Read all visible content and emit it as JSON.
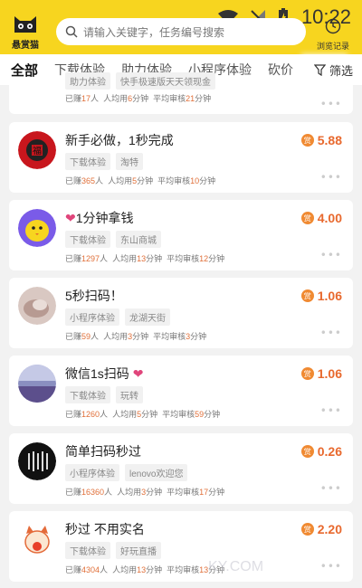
{
  "app": {
    "logo_text": "悬赏猫",
    "time": "10:22",
    "search_placeholder": "请输入关键字，任务编号搜索",
    "history_label": "浏览记录",
    "filter_label": "筛选"
  },
  "tabs": [
    {
      "label": "全部"
    },
    {
      "label": "下载体验"
    },
    {
      "label": "助力体验"
    },
    {
      "label": "小程序体验"
    },
    {
      "label": "砍价"
    }
  ],
  "partial_card": {
    "tags": [
      "助力体验",
      "快手极速版天天领现金"
    ],
    "done_count": "17",
    "avg_time": "6",
    "review_time": "21"
  },
  "tasks": [
    {
      "title": "新手必做，1秒完成",
      "tags": [
        "下载体验",
        "淘特"
      ],
      "price": "5.88",
      "done_count": "365",
      "avg_time": "5",
      "review_time": "10"
    },
    {
      "title": "1分钟拿钱",
      "tags": [
        "下载体验",
        "东山商城"
      ],
      "price": "4.00",
      "done_count": "1297",
      "avg_time": "13",
      "review_time": "12"
    },
    {
      "title": "5秒扫码！",
      "tags": [
        "小程序体验",
        "龙湖天街"
      ],
      "price": "1.06",
      "done_count": "59",
      "avg_time": "3",
      "review_time": "3"
    },
    {
      "title": "微信1s扫码",
      "tags": [
        "下载体验",
        "玩转"
      ],
      "price": "1.06",
      "done_count": "1260",
      "avg_time": "5",
      "review_time": "59"
    },
    {
      "title": "简单扫码秒过",
      "tags": [
        "小程序体验",
        "lenovo欢迎您"
      ],
      "price": "0.26",
      "done_count": "16360",
      "avg_time": "3",
      "review_time": "17"
    },
    {
      "title": "秒过 不用实名",
      "tags": [
        "下载体验",
        "好玩直播"
      ],
      "price": "2.20",
      "done_count": "4304",
      "avg_time": "13",
      "review_time": "13"
    }
  ],
  "labels": {
    "done_prefix": "已赚",
    "people": "人",
    "avg_prefix": "人均用",
    "minutes": "分钟",
    "review_prefix": "平均审核",
    "price_badge": "赏"
  },
  "watermark": "KY.COM",
  "colors": {
    "accent": "#f7d51f",
    "price": "#e8692e"
  }
}
